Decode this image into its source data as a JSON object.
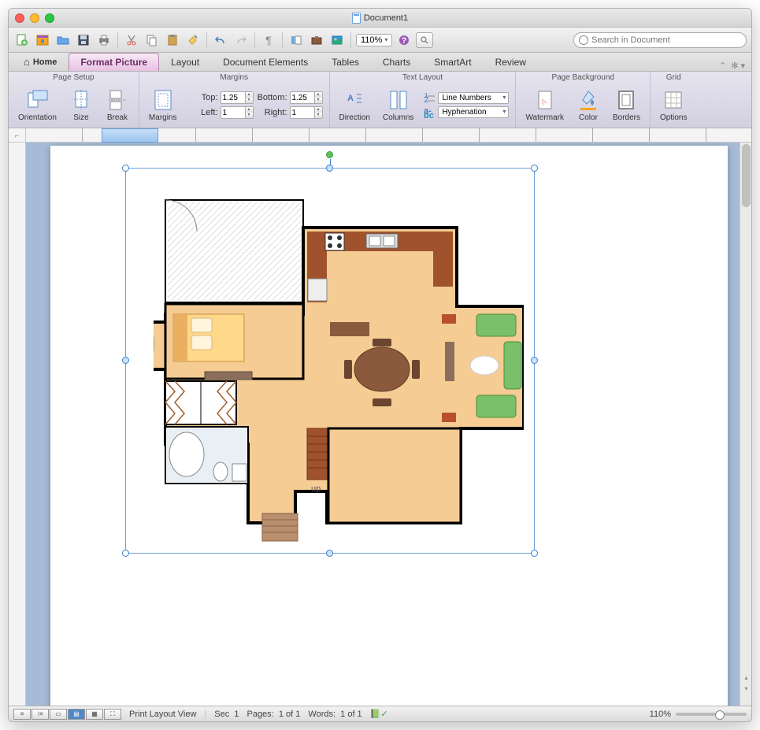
{
  "window": {
    "title": "Document1"
  },
  "toolbar": {
    "zoom": "110%",
    "search_placeholder": "Search in Document"
  },
  "tabs": {
    "home": "Home",
    "format_picture": "Format Picture",
    "layout": "Layout",
    "document_elements": "Document Elements",
    "tables": "Tables",
    "charts": "Charts",
    "smartart": "SmartArt",
    "review": "Review"
  },
  "ribbon": {
    "page_setup": {
      "title": "Page Setup",
      "orientation": "Orientation",
      "size": "Size",
      "break": "Break"
    },
    "margins": {
      "title": "Margins",
      "btn": "Margins",
      "top_label": "Top:",
      "top_value": "1.25",
      "bottom_label": "Bottom:",
      "bottom_value": "1.25",
      "left_label": "Left:",
      "left_value": "1",
      "right_label": "Right:",
      "right_value": "1"
    },
    "text_layout": {
      "title": "Text Layout",
      "direction": "Direction",
      "columns": "Columns",
      "line_numbers": "Line Numbers",
      "hyphenation": "Hyphenation"
    },
    "page_background": {
      "title": "Page Background",
      "watermark": "Watermark",
      "color": "Color",
      "borders": "Borders"
    },
    "grid": {
      "title": "Grid",
      "options": "Options"
    }
  },
  "floorplan": {
    "label_up": "up"
  },
  "status": {
    "view_label": "Print Layout View",
    "sec": "Sec",
    "sec_val": "1",
    "pages": "Pages:",
    "pages_val": "1 of 1",
    "words": "Words:",
    "words_val": "1 of 1",
    "zoom": "110%"
  }
}
